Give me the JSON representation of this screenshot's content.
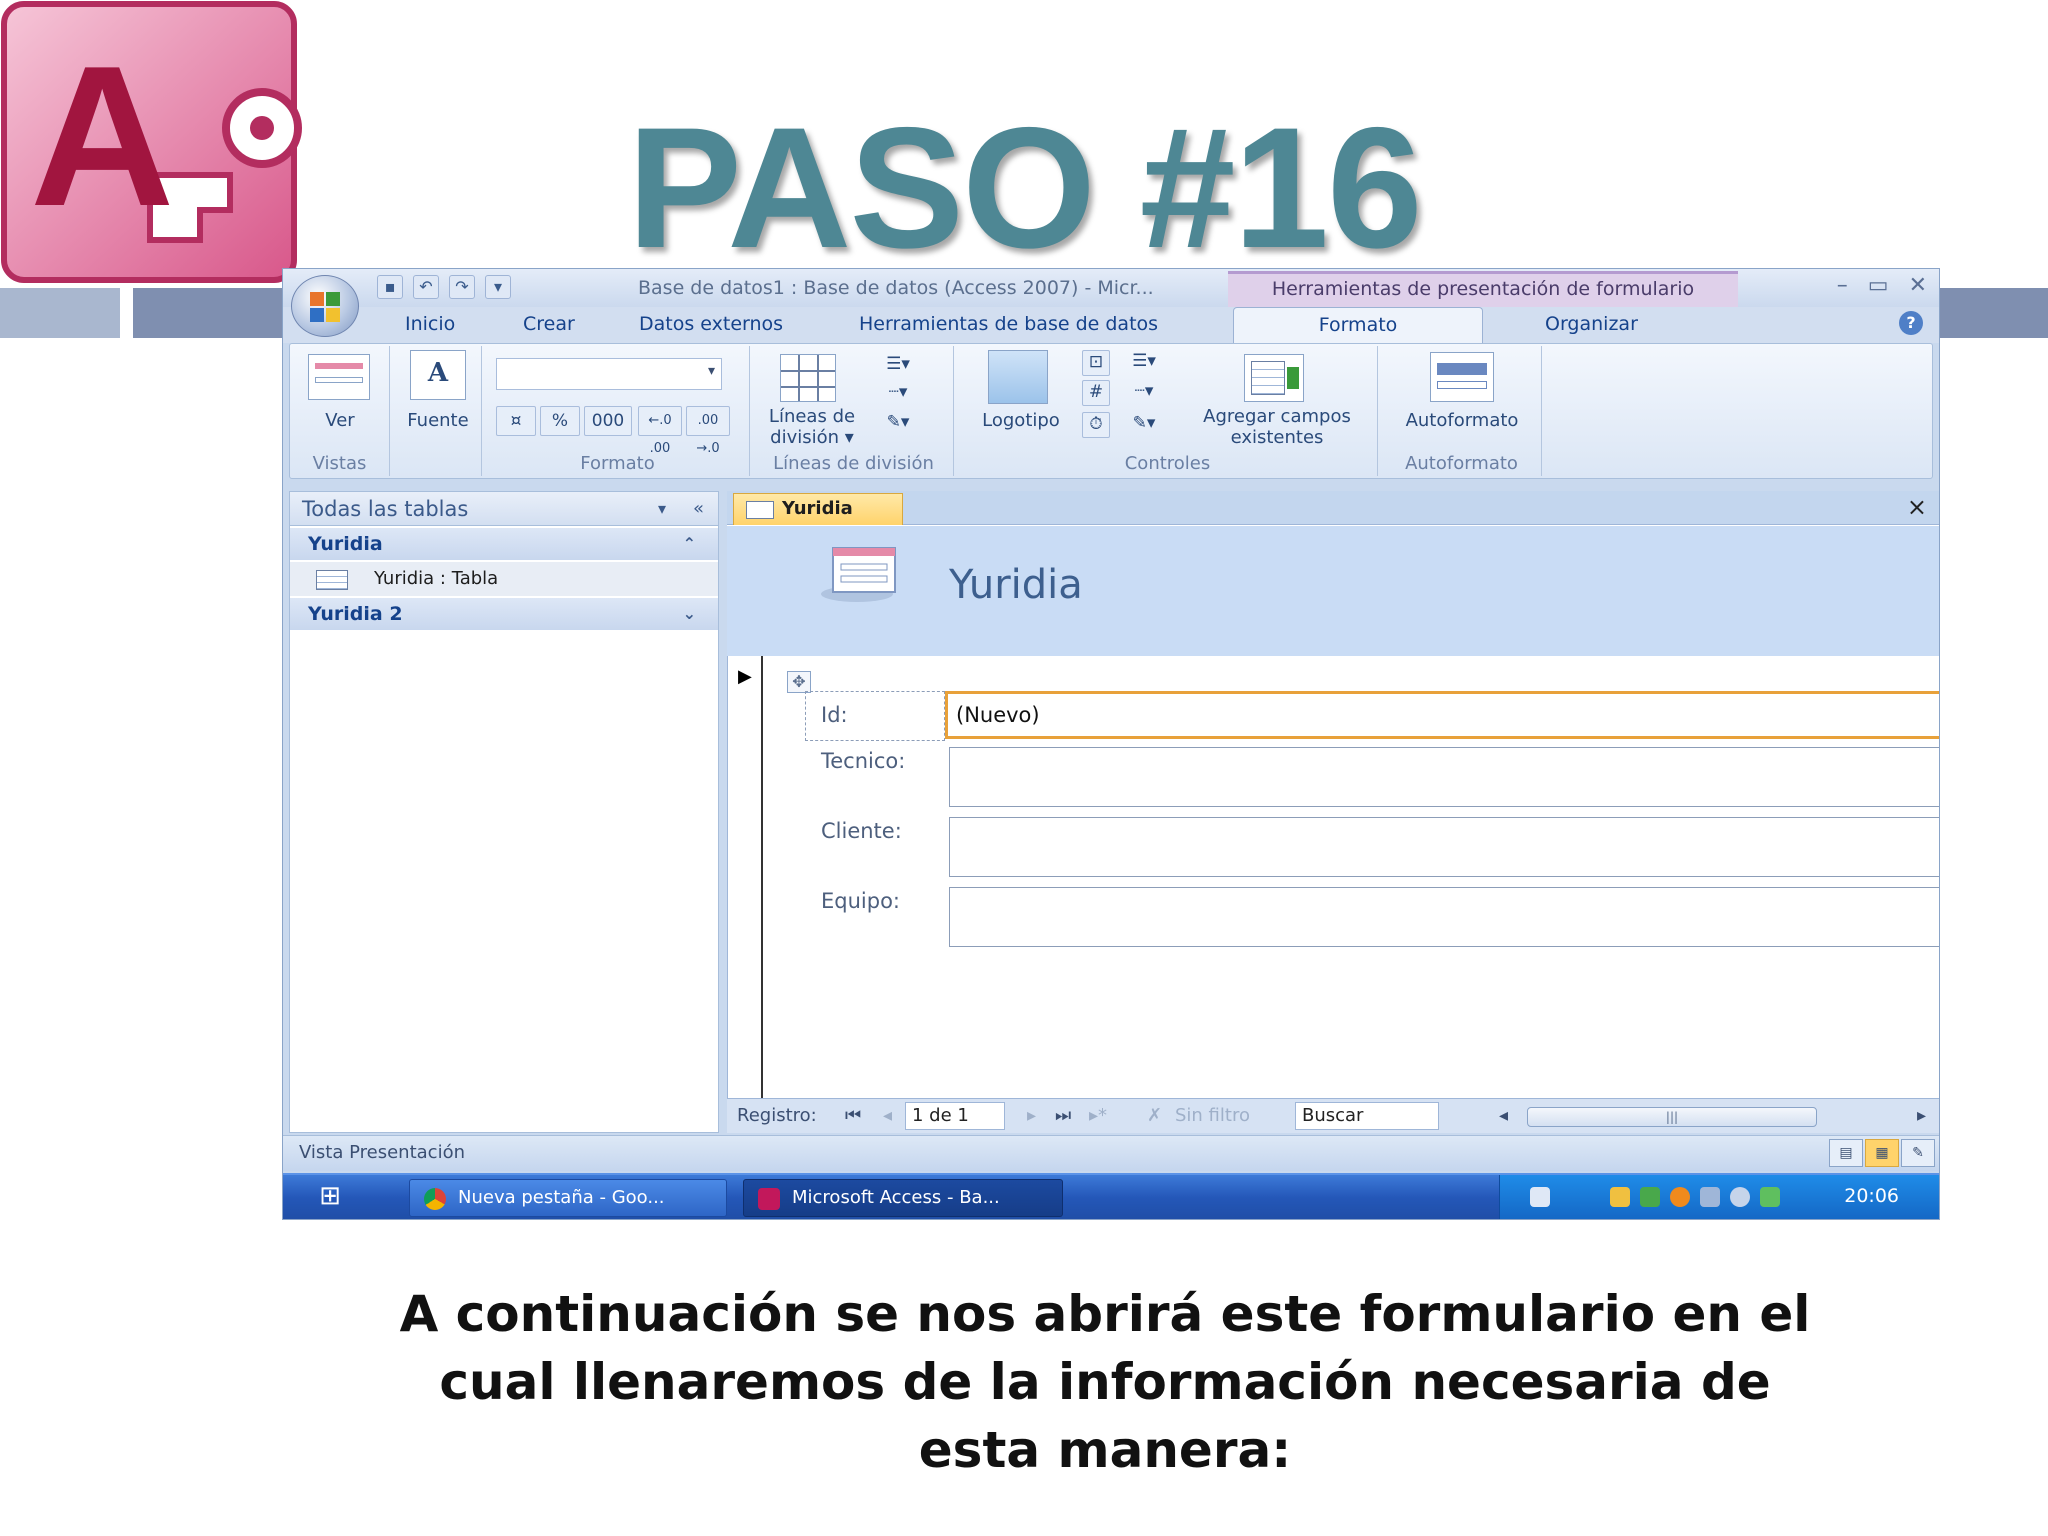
{
  "slide": {
    "title": "PASO #16",
    "caption": "A continuación se nos abrirá este formulario en el cual llenaremos de la información necesaria de esta manera:",
    "logo_letter": "A"
  },
  "window": {
    "title": "Base de datos1 : Base de datos (Access 2007) - Micr...",
    "context_tab_title": "Herramientas de presentación de formulario",
    "controls": [
      "–",
      "▭",
      "✕"
    ],
    "tabs": [
      "Inicio",
      "Crear",
      "Datos externos",
      "Herramientas de base de datos"
    ],
    "context_tabs": {
      "active": "Formato",
      "other": "Organizar"
    }
  },
  "ribbon": {
    "groups": {
      "vistas": {
        "label": "Vistas",
        "button": "Ver"
      },
      "fuente": {
        "button": "Fuente"
      },
      "formato": {
        "label": "Formato",
        "percent": "%",
        "thousands": "000",
        "inc_decimals": "←.0 .00",
        "dec_decimals": ".00 →.0"
      },
      "lineas": {
        "label": "Líneas de división",
        "button_line1": "Líneas de",
        "button_line2": "división ▾"
      },
      "controles": {
        "label": "Controles",
        "logotipo": "Logotipo",
        "agregar_line1": "Agregar campos",
        "agregar_line2": "existentes"
      },
      "autoformato": {
        "label": "Autoformato",
        "button": "Autoformato"
      }
    }
  },
  "nav_pane": {
    "header": "Todas las tablas",
    "groups": [
      {
        "name": "Yuridia",
        "items": [
          "Yuridia : Tabla"
        ]
      },
      {
        "name": "Yuridia 2"
      }
    ]
  },
  "form": {
    "doc_tab": "Yuridia",
    "header_title": "Yuridia",
    "fields": [
      {
        "label": "Id:",
        "value": "(Nuevo)"
      },
      {
        "label": "Tecnico:",
        "value": ""
      },
      {
        "label": "Cliente:",
        "value": ""
      },
      {
        "label": "Equipo:",
        "value": ""
      }
    ],
    "record_nav": {
      "label": "Registro:",
      "position": "1 de 1",
      "filter": "Sin filtro",
      "search": "Buscar"
    }
  },
  "status_bar": {
    "text": "Vista Presentación"
  },
  "taskbar": {
    "tasks": [
      "Nueva pestaña - Goo...",
      "Microsoft Access - Ba..."
    ],
    "clock": "20:06"
  },
  "colors": {
    "title": "#4e8794",
    "ribbon_accent": "#15428b",
    "active_field": "#e8a13a"
  }
}
